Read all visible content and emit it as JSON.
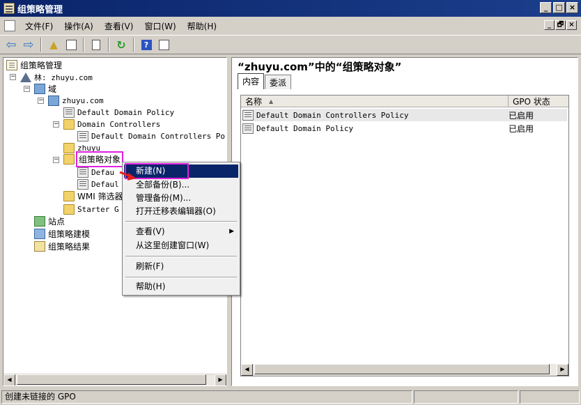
{
  "window": {
    "title": "组策略管理",
    "controls": [
      "_",
      "□",
      "×"
    ]
  },
  "menubar": {
    "items": [
      "文件(F)",
      "操作(A)",
      "查看(V)",
      "窗口(W)",
      "帮助(H)"
    ],
    "mdi_controls": [
      "_",
      "🗗",
      "×"
    ]
  },
  "toolbar": {
    "icons": [
      "back-arrow-icon",
      "forward-arrow-icon",
      "up-folder-icon",
      "show-hide-tree-icon",
      "properties-icon",
      "refresh-icon",
      "help-icon",
      "show-hide-action-pane-icon"
    ]
  },
  "tree": {
    "root": "组策略管理",
    "forest": "林: zhuyu.com",
    "domains": "域",
    "domain": "zhuyu.com",
    "default_domain_policy": "Default Domain Policy",
    "domain_controllers": "Domain Controllers",
    "default_dc_policy": "Default Domain Controllers Po",
    "ou_zhuyu": "zhuyu",
    "gpo_container": "组策略对象",
    "gpo_child1": "Defau",
    "gpo_child2": "Defaul",
    "wmi_filters": "WMI 筛选器",
    "starter_gpos": "Starter G",
    "sites": "站点",
    "modeling": "组策略建模",
    "results": "组策略结果"
  },
  "right_pane": {
    "heading": "“zhuyu.com”中的“组策略对象”",
    "tabs": [
      "内容",
      "委派"
    ],
    "columns": {
      "name": "名称",
      "status": "GPO 状态"
    },
    "rows": [
      {
        "name": "Default Domain Controllers Policy",
        "status": "已启用"
      },
      {
        "name": "Default Domain Policy",
        "status": "已启用"
      }
    ]
  },
  "context_menu": {
    "items": [
      {
        "label": "新建(N)",
        "highlighted": true
      },
      {
        "label": "全部备份(B)..."
      },
      {
        "label": "管理备份(M)..."
      },
      {
        "label": "打开迁移表编辑器(O)"
      },
      {
        "label": "查看(V)",
        "submenu": true
      },
      {
        "label": "从这里创建窗口(W)"
      },
      {
        "label": "刷新(F)"
      },
      {
        "label": "帮助(H)"
      }
    ]
  },
  "statusbar": {
    "text": "创建未链接的 GPO"
  },
  "colors": {
    "title_bar": "#0a246a",
    "highlight": "#0a246a",
    "annotation_box": "#e020e0",
    "annotation_arrow": "#e02020"
  }
}
